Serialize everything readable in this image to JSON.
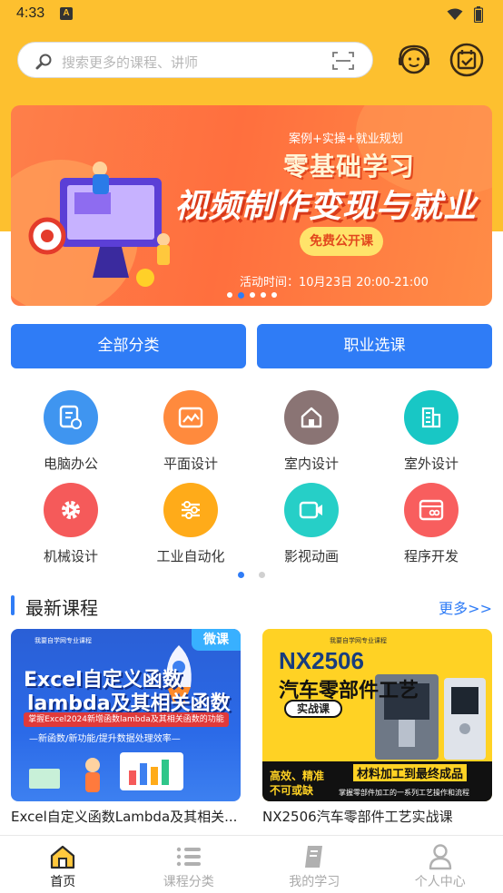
{
  "status_bar": {
    "time": "4:33",
    "notification_icon": "A"
  },
  "search": {
    "placeholder": "搜索更多的课程、讲师"
  },
  "header_icons": {
    "service": "customer-service-icon",
    "checkin": "calendar-check-icon"
  },
  "banner": {
    "tagline": "案例+实操+就业规划",
    "title1": "零基础学习",
    "title2": "视频制作变现与就业",
    "button": "免费公开课",
    "time": "活动时间：10月23日 20:00-21:00",
    "active_dot": 1,
    "dot_count": 5
  },
  "category_buttons": {
    "all": "全部分类",
    "career": "职业选课"
  },
  "grid": [
    {
      "label": "电脑办公",
      "color": "#3f95f0",
      "icon": "document-icon"
    },
    {
      "label": "平面设计",
      "color": "#ff8a3d",
      "icon": "image-icon"
    },
    {
      "label": "室内设计",
      "color": "#8a7474",
      "icon": "house-icon"
    },
    {
      "label": "室外设计",
      "color": "#18c7c5",
      "icon": "building-icon"
    },
    {
      "label": "机械设计",
      "color": "#f55a5a",
      "icon": "gear-icon"
    },
    {
      "label": "工业自动化",
      "color": "#ffab19",
      "icon": "sliders-icon"
    },
    {
      "label": "影视动画",
      "color": "#26cfc7",
      "icon": "video-camera-icon"
    },
    {
      "label": "程序开发",
      "color": "#f85e5e",
      "icon": "code-window-icon"
    }
  ],
  "section": {
    "title": "最新课程",
    "more": "更多>>"
  },
  "courses": [
    {
      "title": "Excel自定义函数Lambda及其相关...",
      "badge": "微课",
      "thumb_header": "我要自学网专业课程",
      "thumb_line1": "Excel自定义函数",
      "thumb_line2": "lambda及其相关函数",
      "thumb_ribbon": "掌握Excel2024新增函数lambda及其相关函数的功能",
      "thumb_sub": "—新函数/新功能/提升数据处理效率—"
    },
    {
      "title": "NX2506汽车零部件工艺实战课",
      "thumb_header": "我要自学网专业课程",
      "thumb_line1": "NX2506",
      "thumb_line2": "汽车零部件工艺",
      "thumb_tag": "实战课",
      "thumb_b1": "高效、精准",
      "thumb_b2": "不可或缺",
      "thumb_b3": "材料加工到最终成品",
      "thumb_b4": "掌握零部件加工的一系列工艺操作和流程"
    }
  ],
  "tabs": [
    {
      "label": "首页",
      "icon": "home-icon",
      "active": true
    },
    {
      "label": "课程分类",
      "icon": "list-icon",
      "active": false
    },
    {
      "label": "我的学习",
      "icon": "book-icon",
      "active": false
    },
    {
      "label": "个人中心",
      "icon": "person-icon",
      "active": false
    }
  ],
  "colors": {
    "brand_yellow": "#fdc02f",
    "accent_blue": "#2f7cf6"
  }
}
